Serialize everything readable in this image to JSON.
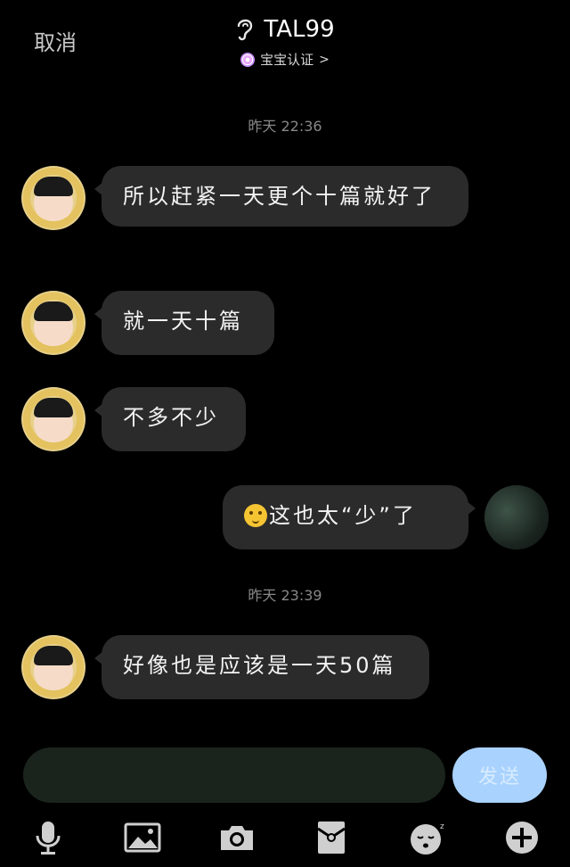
{
  "header": {
    "cancel_label": "取消",
    "title": "TAL99",
    "subtitle": "宝宝认证",
    "subtitle_chevron": ">"
  },
  "timestamps": [
    {
      "text": "昨天 22:36"
    },
    {
      "text": "昨天 23:39"
    }
  ],
  "messages": [
    {
      "sender": "other",
      "text": "所以赶紧一天更个十篇就好了"
    },
    {
      "sender": "other",
      "text": "就一天十篇"
    },
    {
      "sender": "other",
      "text": "不多不少"
    },
    {
      "sender": "me",
      "text": "这也太“少”了",
      "emoji": "smile-emoji"
    },
    {
      "sender": "other",
      "text": "好像也是应该是一天50篇"
    }
  ],
  "composer": {
    "input_value": "",
    "send_label": "发送"
  },
  "toolbar": {
    "icons": [
      "microphone-icon",
      "image-icon",
      "camera-icon",
      "red-packet-icon",
      "sticker-icon",
      "plus-icon"
    ]
  },
  "colors": {
    "background": "#000000",
    "bubble": "#2b2b2b",
    "send_button": "#a9d2ff",
    "input": "#1a241d"
  }
}
